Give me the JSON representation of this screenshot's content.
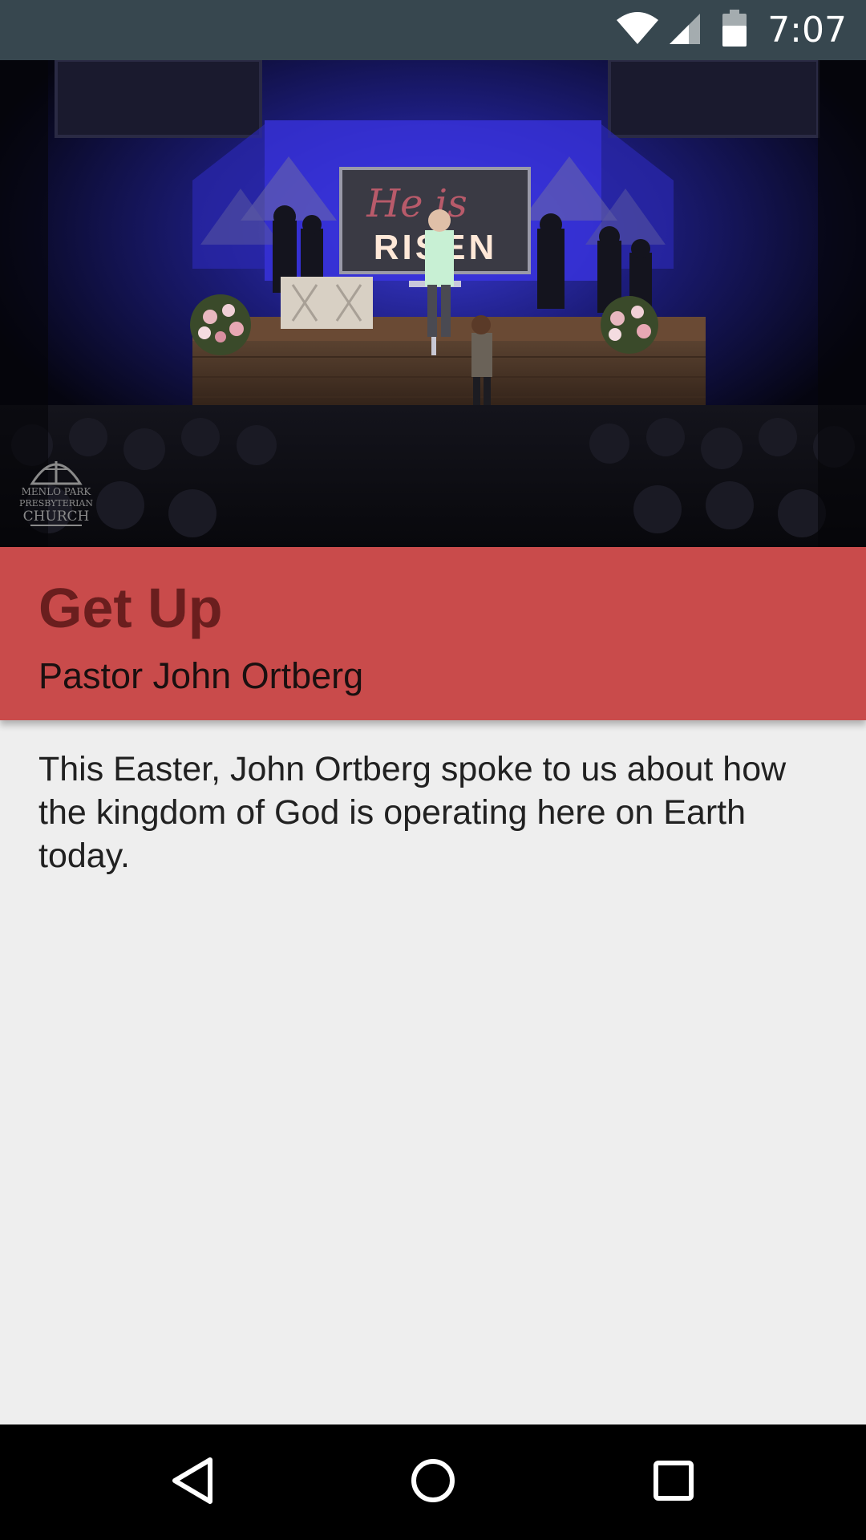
{
  "status_bar": {
    "time": "7:07",
    "icons": [
      "wifi-icon",
      "cell-signal-icon",
      "battery-icon"
    ]
  },
  "media": {
    "description_note_hidden": "",
    "backdrop_text_top": "He is",
    "backdrop_text_bottom": "RISEN",
    "logo_line1": "MENLO PARK",
    "logo_line2": "PRESBYTERIAN",
    "logo_line3": "CHURCH"
  },
  "sermon": {
    "title": "Get Up",
    "speaker": "Pastor John Ortberg",
    "description": "This Easter, John Ortberg spoke to us about how the kingdom of God is operating here on Earth today."
  },
  "nav_bar": {
    "buttons": [
      "back-icon",
      "home-icon",
      "recents-icon"
    ]
  },
  "colors": {
    "status_bar": "#37474f",
    "title_band": "#c94b4b",
    "title_text": "#6a1e1e",
    "background": "#eeeeee",
    "nav_bar": "#000000"
  }
}
